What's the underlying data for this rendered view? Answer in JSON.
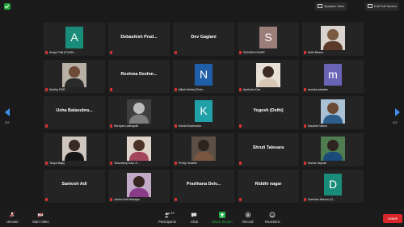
{
  "topbar": {
    "speaker_view": "Speaker View",
    "exit_full_screen": "Exit Full Screen"
  },
  "pager": {
    "left": "2/2",
    "right": "2/2"
  },
  "tiles": [
    {
      "label": "Anuja Patil (PGDM ...",
      "kind": "letter",
      "letter": "A",
      "color": "#1a8d7a"
    },
    {
      "label": "Debashish Prad...",
      "kind": "name"
    },
    {
      "label": "Dev Gaglani",
      "kind": "name"
    },
    {
      "label": "SHIVAM KHARE",
      "kind": "letter",
      "letter": "S",
      "color": "#9b7e7a"
    },
    {
      "label": "Akhil Bhanu",
      "kind": "photo",
      "head": "#7a5a40",
      "body": "#5b3a2a",
      "bg": "#d9d4cf"
    },
    {
      "label": "Murthy RSR",
      "kind": "photo",
      "head": "#6d4b36",
      "body": "#2a2a2a",
      "bg": "#b8b0a4"
    },
    {
      "label": "Reshma Deshm...",
      "kind": "name"
    },
    {
      "label": "Nitish Mehta (Rete...",
      "kind": "letter",
      "letter": "N",
      "color": "#1f5fa8"
    },
    {
      "label": "Apeksha Das",
      "kind": "photo",
      "head": "#3d2a22",
      "body": "#d8c7b5",
      "bg": "#e8e0d6"
    },
    {
      "label": "monika saladke",
      "kind": "letter",
      "letter": "m",
      "color": "#6a64b7"
    },
    {
      "label": "Usha Balasubra...",
      "kind": "name"
    },
    {
      "label": "Shreyas Ladhapati",
      "kind": "photo",
      "head": "#bcbcbc",
      "body": "#7c7c7c",
      "bg": "#3e3e3e"
    },
    {
      "label": "Kavita Kushwaha",
      "kind": "letter",
      "letter": "K",
      "color": "#20a0a7"
    },
    {
      "label": "Yogesh (Delhi)",
      "kind": "name"
    },
    {
      "label": "Kaushal Varuni",
      "kind": "photo",
      "head": "#6b4a33",
      "body": "#2d5e8a",
      "bg": "#a9c1d3"
    },
    {
      "label": "Tanya Bajaj",
      "kind": "photo",
      "head": "#3a2a24",
      "body": "#161616",
      "bg": "#cfc7bf"
    },
    {
      "label": "Tarundeep Kaur A...",
      "kind": "photo",
      "head": "#4a3326",
      "body": "#a3475d",
      "bg": "#ddd3c8"
    },
    {
      "label": "Pretty Sarathe",
      "kind": "photo",
      "head": "#2d2420",
      "body": "#7a5640",
      "bg": "#5c5046"
    },
    {
      "label": "Shruti Talesara",
      "kind": "name"
    },
    {
      "label": "Kumar Aayush",
      "kind": "photo",
      "head": "#2f2420",
      "body": "#1a4b7a",
      "bg": "#4f7d4f"
    },
    {
      "label": "Santosh Adi",
      "kind": "name"
    },
    {
      "label": "Janhvi Anil Mahajan",
      "kind": "photo",
      "head": "#352520",
      "body": "#8a3b8a",
      "bg": "#c1a9c7"
    },
    {
      "label": "Prarthana Deiv...",
      "kind": "name"
    },
    {
      "label": "Riddhi nagar",
      "kind": "name"
    },
    {
      "label": "Darshan Nakum (G...",
      "kind": "letter",
      "letter": "D",
      "color": "#1a8d7a"
    }
  ],
  "toolbar": {
    "unmute": "Unmute",
    "start_video": "Start Video",
    "participants": "Participants",
    "participants_count": "43",
    "chat": "Chat",
    "share_screen": "Share Screen",
    "record": "Record",
    "reactions": "Reactions",
    "leave": "Leave"
  }
}
